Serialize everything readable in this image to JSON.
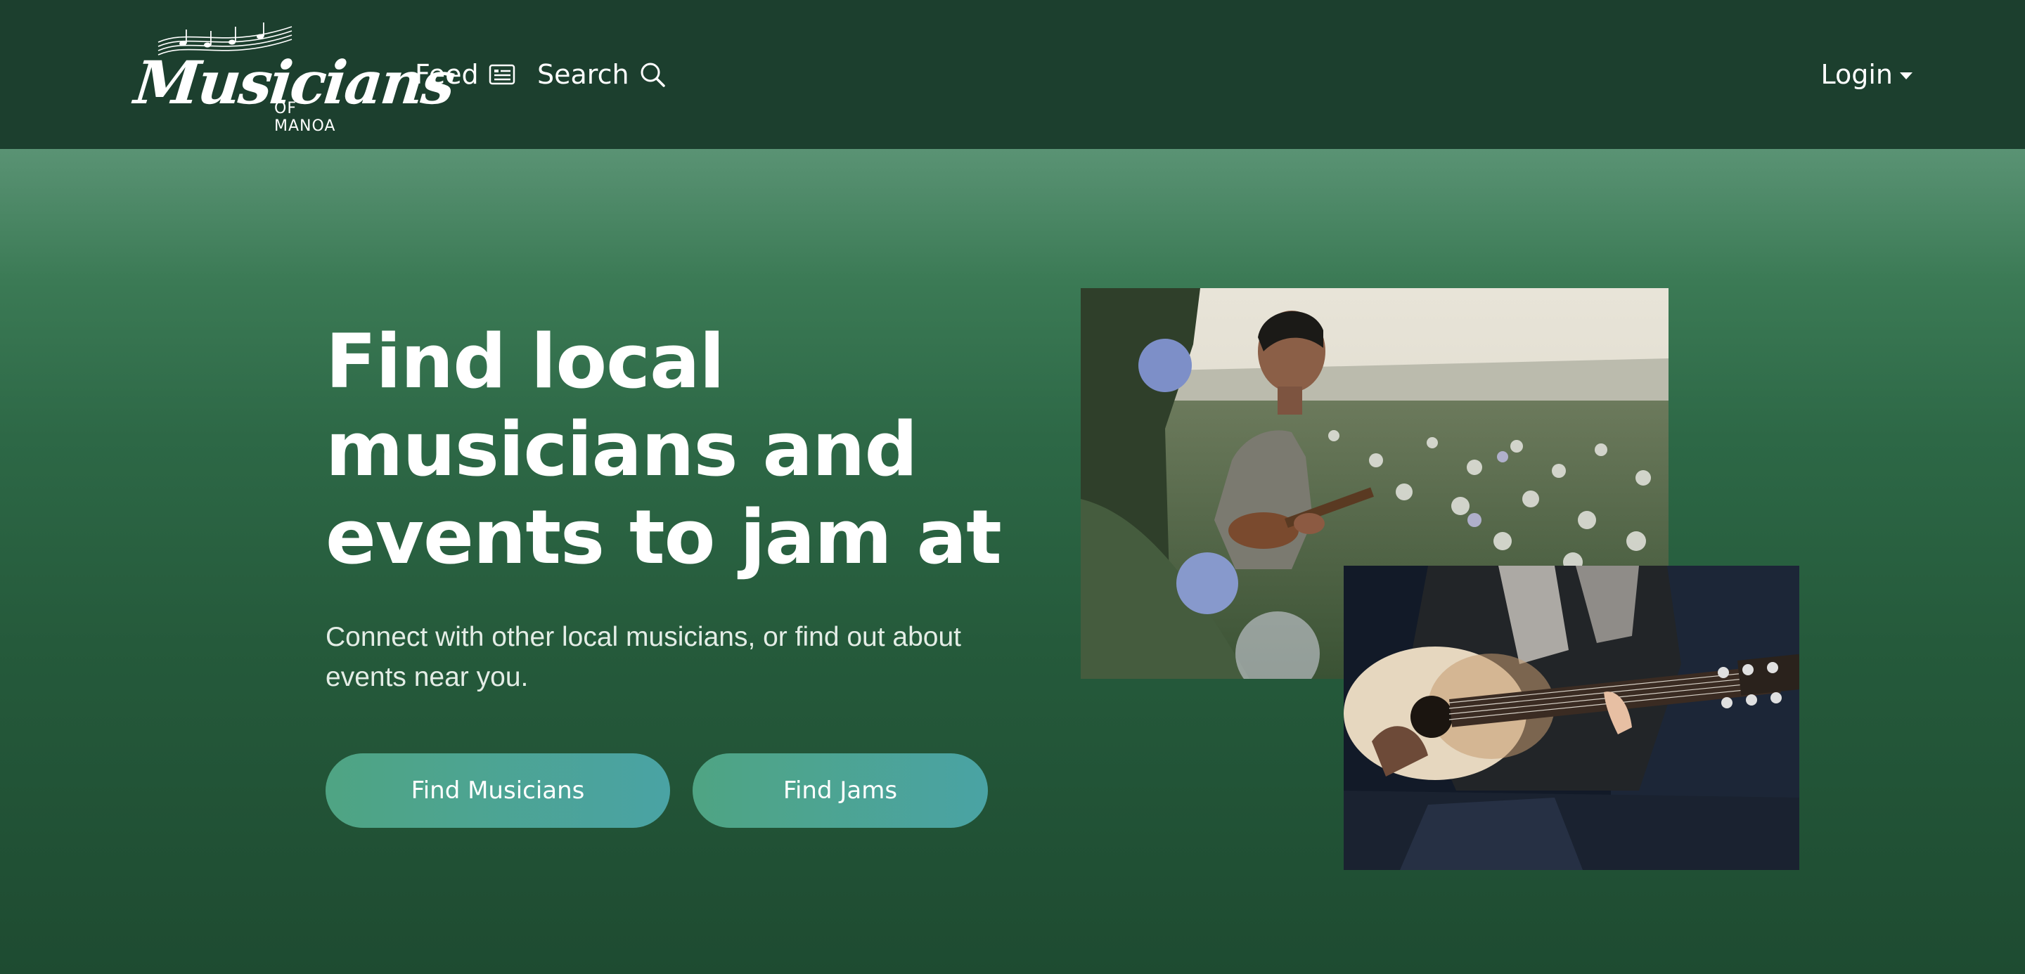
{
  "nav": {
    "logo": {
      "title": "Musicians",
      "subtitle": "OF MANOA"
    },
    "feed_label": "Feed",
    "search_label": "Search",
    "login_label": "Login"
  },
  "hero": {
    "headline_lines": [
      "Find local",
      "musicians and",
      "events to jam at"
    ],
    "subtext": "Connect with other local musicians, or find out about events near you.",
    "buttons": {
      "find_musicians": "Find Musicians",
      "find_jams": "Find Jams"
    }
  },
  "colors": {
    "navbar": "#1c3f2e",
    "hero_top": "#5a9374",
    "hero_bottom": "#1e4b31",
    "button_start": "#4fa483",
    "button_end": "#4aa3a4"
  },
  "icons": [
    "newspaper-icon",
    "search-icon",
    "caret-down-icon",
    "music-staff-icon"
  ]
}
